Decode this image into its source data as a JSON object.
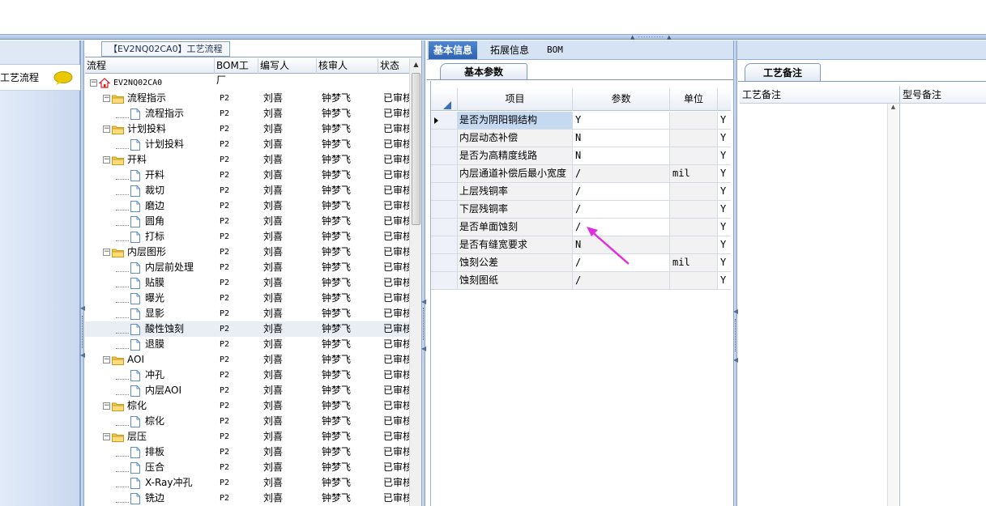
{
  "nav": {
    "item_label": "工艺流程",
    "chat_icon_color": "#e9c800"
  },
  "tree": {
    "title": "【EV2NQ02CA0】工艺流程",
    "columns": [
      "流程",
      "BOM工厂",
      "编写人",
      "核审人",
      "状态"
    ],
    "rows": [
      {
        "name": "EV2NQ02CA0",
        "level": 0,
        "kind": "root",
        "factory": "",
        "author": "",
        "reviewer": "",
        "status": ""
      },
      {
        "name": "流程指示",
        "level": 1,
        "kind": "folder",
        "factory": "P2",
        "author": "刘喜",
        "reviewer": "钟梦飞",
        "status": "已审核"
      },
      {
        "name": "流程指示",
        "level": 2,
        "kind": "doc",
        "factory": "P2",
        "author": "刘喜",
        "reviewer": "钟梦飞",
        "status": "已审核"
      },
      {
        "name": "计划投料",
        "level": 1,
        "kind": "folder",
        "factory": "P2",
        "author": "刘喜",
        "reviewer": "钟梦飞",
        "status": "已审核"
      },
      {
        "name": "计划投料",
        "level": 2,
        "kind": "doc",
        "factory": "P2",
        "author": "刘喜",
        "reviewer": "钟梦飞",
        "status": "已审核"
      },
      {
        "name": "开料",
        "level": 1,
        "kind": "folder",
        "factory": "P2",
        "author": "刘喜",
        "reviewer": "钟梦飞",
        "status": "已审核"
      },
      {
        "name": "开料",
        "level": 2,
        "kind": "doc",
        "factory": "P2",
        "author": "刘喜",
        "reviewer": "钟梦飞",
        "status": "已审核"
      },
      {
        "name": "裁切",
        "level": 2,
        "kind": "doc",
        "factory": "P2",
        "author": "刘喜",
        "reviewer": "钟梦飞",
        "status": "已审核"
      },
      {
        "name": "磨边",
        "level": 2,
        "kind": "doc",
        "factory": "P2",
        "author": "刘喜",
        "reviewer": "钟梦飞",
        "status": "已审核"
      },
      {
        "name": "圆角",
        "level": 2,
        "kind": "doc",
        "factory": "P2",
        "author": "刘喜",
        "reviewer": "钟梦飞",
        "status": "已审核"
      },
      {
        "name": "打标",
        "level": 2,
        "kind": "doc",
        "factory": "P2",
        "author": "刘喜",
        "reviewer": "钟梦飞",
        "status": "已审核"
      },
      {
        "name": "内层图形",
        "level": 1,
        "kind": "folder",
        "factory": "P2",
        "author": "刘喜",
        "reviewer": "钟梦飞",
        "status": "已审核"
      },
      {
        "name": "内层前处理",
        "level": 2,
        "kind": "doc",
        "factory": "P2",
        "author": "刘喜",
        "reviewer": "钟梦飞",
        "status": "已审核"
      },
      {
        "name": "贴膜",
        "level": 2,
        "kind": "doc",
        "factory": "P2",
        "author": "刘喜",
        "reviewer": "钟梦飞",
        "status": "已审核"
      },
      {
        "name": "曝光",
        "level": 2,
        "kind": "doc",
        "factory": "P2",
        "author": "刘喜",
        "reviewer": "钟梦飞",
        "status": "已审核"
      },
      {
        "name": "显影",
        "level": 2,
        "kind": "doc",
        "factory": "P2",
        "author": "刘喜",
        "reviewer": "钟梦飞",
        "status": "已审核"
      },
      {
        "name": "酸性蚀刻",
        "level": 2,
        "kind": "doc",
        "factory": "P2",
        "author": "刘喜",
        "reviewer": "钟梦飞",
        "status": "已审核",
        "selected": true
      },
      {
        "name": "退膜",
        "level": 2,
        "kind": "doc",
        "factory": "P2",
        "author": "刘喜",
        "reviewer": "钟梦飞",
        "status": "已审核"
      },
      {
        "name": "AOI",
        "level": 1,
        "kind": "folder",
        "factory": "P2",
        "author": "刘喜",
        "reviewer": "钟梦飞",
        "status": "已审核"
      },
      {
        "name": "冲孔",
        "level": 2,
        "kind": "doc",
        "factory": "P2",
        "author": "刘喜",
        "reviewer": "钟梦飞",
        "status": "已审核"
      },
      {
        "name": "内层AOI",
        "level": 2,
        "kind": "doc",
        "factory": "P2",
        "author": "刘喜",
        "reviewer": "钟梦飞",
        "status": "已审核"
      },
      {
        "name": "棕化",
        "level": 1,
        "kind": "folder",
        "factory": "P2",
        "author": "刘喜",
        "reviewer": "钟梦飞",
        "status": "已审核"
      },
      {
        "name": "棕化",
        "level": 2,
        "kind": "doc",
        "factory": "P2",
        "author": "刘喜",
        "reviewer": "钟梦飞",
        "status": "已审核"
      },
      {
        "name": "层压",
        "level": 1,
        "kind": "folder",
        "factory": "P2",
        "author": "刘喜",
        "reviewer": "钟梦飞",
        "status": "已审核"
      },
      {
        "name": "排板",
        "level": 2,
        "kind": "doc",
        "factory": "P2",
        "author": "刘喜",
        "reviewer": "钟梦飞",
        "status": "已审核"
      },
      {
        "name": "压合",
        "level": 2,
        "kind": "doc",
        "factory": "P2",
        "author": "刘喜",
        "reviewer": "钟梦飞",
        "status": "已审核"
      },
      {
        "name": "X-Ray冲孔",
        "level": 2,
        "kind": "doc",
        "factory": "P2",
        "author": "刘喜",
        "reviewer": "钟梦飞",
        "status": "已审核"
      },
      {
        "name": "铣边",
        "level": 2,
        "kind": "doc",
        "factory": "P2",
        "author": "刘喜",
        "reviewer": "钟梦飞",
        "status": "已审核"
      }
    ]
  },
  "center": {
    "tabs": [
      "基本信息",
      "拓展信息",
      "BOM"
    ],
    "active_tab": 0,
    "sub_tab": "基本参数",
    "grid_columns": [
      "项目",
      "参数",
      "单位"
    ],
    "params": [
      {
        "item": "是否为阴阳铜结构",
        "value": "Y",
        "unit": "",
        "flag": "Y",
        "selected": true
      },
      {
        "item": "内层动态补偿",
        "value": "N",
        "unit": "",
        "flag": "Y"
      },
      {
        "item": "是否为高精度线路",
        "value": "N",
        "unit": "",
        "flag": "Y"
      },
      {
        "item": "内层通道补偿后最小宽度",
        "value": "/",
        "unit": "mil",
        "flag": "Y",
        "grey": true
      },
      {
        "item": "上层残铜率",
        "value": "/",
        "unit": "",
        "flag": "Y"
      },
      {
        "item": "下层残铜率",
        "value": "/",
        "unit": "",
        "flag": "Y"
      },
      {
        "item": "是否单面蚀刻",
        "value": "/",
        "unit": "",
        "flag": "Y"
      },
      {
        "item": "是否有缝宽要求",
        "value": "N",
        "unit": "",
        "flag": "Y",
        "grey": true
      },
      {
        "item": "蚀刻公差",
        "value": "/",
        "unit": "mil",
        "flag": "Y"
      },
      {
        "item": "蚀刻图纸",
        "value": "/",
        "unit": "",
        "flag": "Y",
        "grey": true
      }
    ],
    "annotation_color": "#e22ce0"
  },
  "right": {
    "tab": "工艺备注",
    "columns": [
      "工艺备注",
      "型号备注"
    ]
  }
}
